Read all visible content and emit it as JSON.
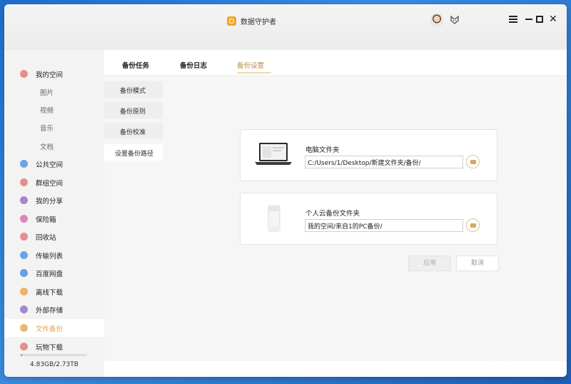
{
  "app": {
    "title": "数据守护者"
  },
  "sidebar": {
    "items": [
      {
        "label": "我的空间",
        "type": "main",
        "color": "#e57373"
      },
      {
        "label": "图片",
        "type": "sub"
      },
      {
        "label": "视频",
        "type": "sub"
      },
      {
        "label": "音乐",
        "type": "sub"
      },
      {
        "label": "文档",
        "type": "sub"
      },
      {
        "label": "公共空间",
        "type": "main",
        "color": "#4a90e2"
      },
      {
        "label": "群组空间",
        "type": "main",
        "color": "#e57373"
      },
      {
        "label": "我的分享",
        "type": "main",
        "color": "#8e6cc8"
      },
      {
        "label": "保险箱",
        "type": "main",
        "color": "#d46cb0"
      },
      {
        "label": "回收站",
        "type": "main",
        "color": "#e57373"
      },
      {
        "label": "传输列表",
        "type": "main",
        "color": "#4a90e2"
      },
      {
        "label": "百度网盘",
        "type": "main",
        "color": "#3b8be0"
      },
      {
        "label": "离线下载",
        "type": "main",
        "color": "#f0a040"
      },
      {
        "label": "外部存储",
        "type": "main",
        "color": "#8e6cc8"
      },
      {
        "label": "文件备份",
        "type": "main",
        "color": "#e8a54a",
        "active": true
      },
      {
        "label": "玩物下载",
        "type": "main",
        "color": "#e57373"
      }
    ],
    "storage": {
      "text": "4.83GB/2.73TB",
      "fraction": 0.017
    }
  },
  "tabs": [
    {
      "label": "备份任务"
    },
    {
      "label": "备份日志"
    },
    {
      "label": "备份设置",
      "active": true
    }
  ],
  "subnav": [
    {
      "label": "备份模式"
    },
    {
      "label": "备份原则"
    },
    {
      "label": "备份校准"
    },
    {
      "label": "设置备份路径",
      "active": true
    }
  ],
  "pc_folder": {
    "title": "电脑文件夹",
    "path": "C:/Users/1/Desktop/新建文件夹/备份/"
  },
  "cloud_folder": {
    "title": "个人云备份文件夹",
    "path": "我的空间/来自1的PC备份/"
  },
  "buttons": {
    "apply": "应用",
    "cancel": "取消"
  },
  "colors": {
    "accent": "#e8a54a",
    "tab_active": "#b88a4e"
  }
}
